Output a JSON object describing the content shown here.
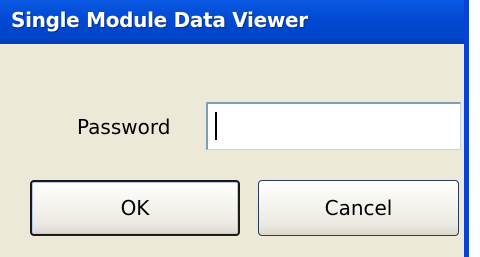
{
  "window": {
    "title": "Single Module Data Viewer"
  },
  "form": {
    "password_label": "Password",
    "password_value": ""
  },
  "buttons": {
    "ok_label": "OK",
    "cancel_label": "Cancel"
  },
  "colors": {
    "titlebar": "#0049d0",
    "dialog_background": "#ece9d8",
    "window_border": "#0a3fd8"
  }
}
